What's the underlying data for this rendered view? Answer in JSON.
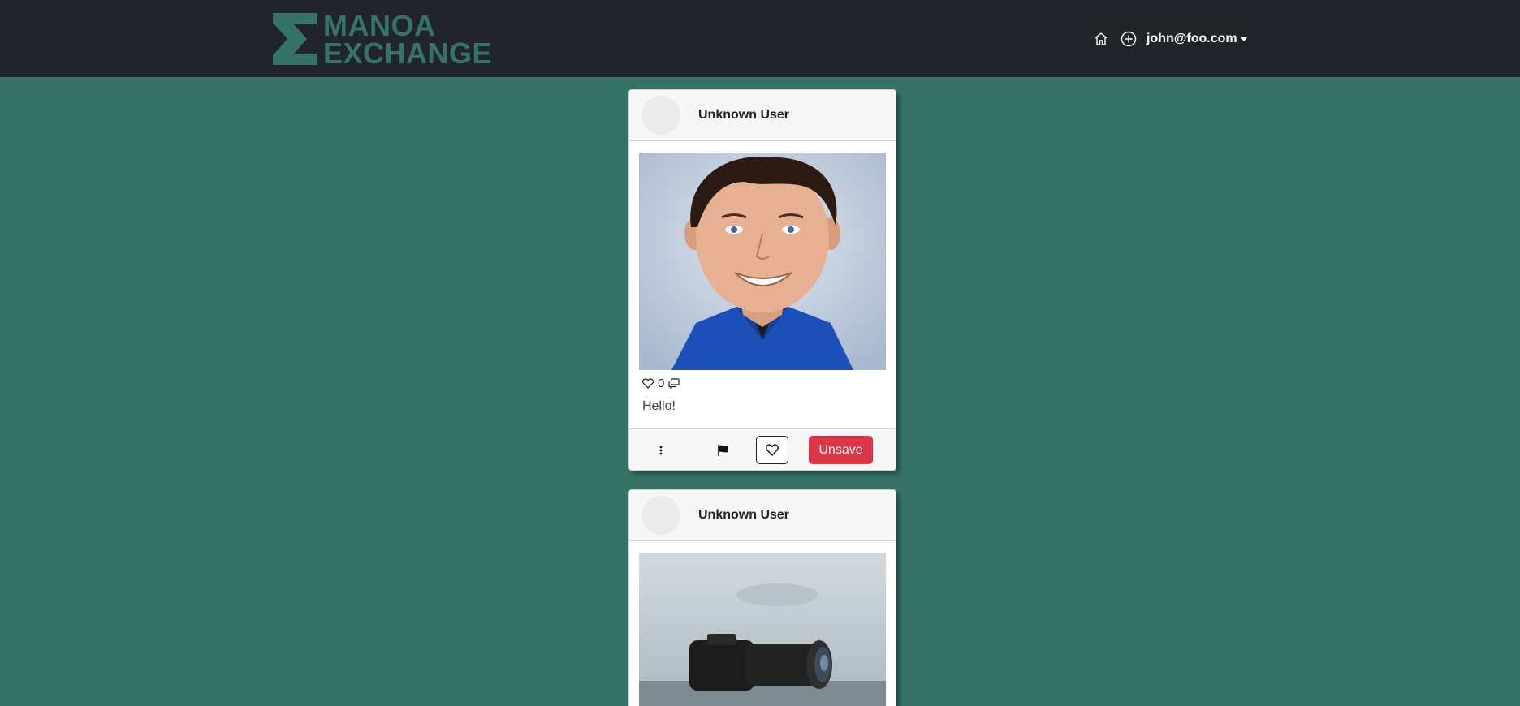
{
  "navbar": {
    "logo_line1": "MANOA",
    "logo_line2": "EXCHANGE",
    "home_icon": "home-icon",
    "add_icon": "plus-circle-icon",
    "user_email": "john@foo.com"
  },
  "colors": {
    "background": "#357367",
    "navbar": "#212529",
    "logo": "#357367",
    "unsave_button": "#dc3545"
  },
  "posts": [
    {
      "username": "Unknown User",
      "image": "photo of a smiling man in a blue shirt",
      "likes": "0",
      "caption": "Hello!",
      "unsave_label": "Unsave"
    },
    {
      "username": "Unknown User",
      "image": "photo of a camera with lens"
    }
  ]
}
